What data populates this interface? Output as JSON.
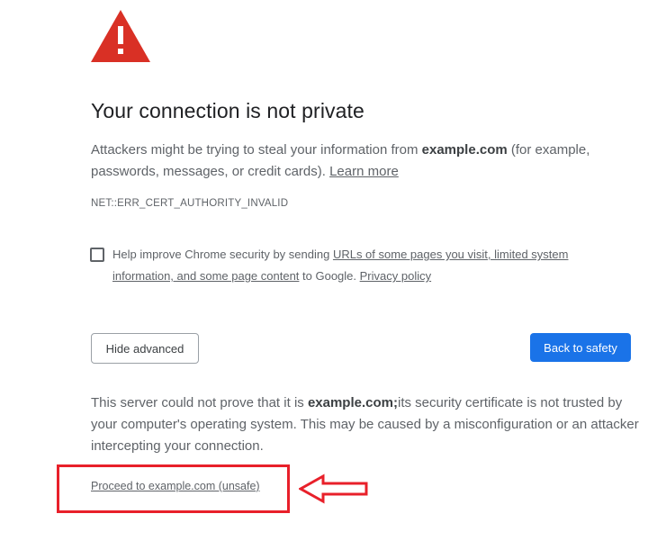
{
  "page": {
    "title": "Your connection is not private",
    "intro": {
      "text1": "Attackers might be trying to steal your information from ",
      "domain": "example.com",
      "text2": " (for example, passwords, messages, or credit cards). ",
      "learn_more": "Learn more"
    },
    "error_code": "NET::ERR_CERT_AUTHORITY_INVALID",
    "optin": {
      "text1": "Help improve Chrome security by sending ",
      "link1": "URLs of some pages you visit, limited system information, and some page content",
      "text2": " to Google. ",
      "privacy_policy": "Privacy policy",
      "checked": false
    },
    "buttons": {
      "hide_advanced": "Hide advanced",
      "back_to_safety": "Back to safety"
    },
    "details": {
      "text1": "This server could not prove that it is ",
      "domain": "example.com;",
      "text2": "its security certificate is not trusted by your computer's operating system. This may be caused by a misconfiguration or an attacker intercepting your connection."
    },
    "proceed_link": "Proceed to example.com (unsafe)"
  },
  "icons": {
    "warning": "warning-triangle-icon",
    "annotation_arrow": "left-arrow-icon"
  },
  "colors": {
    "primary": "#1a73e8",
    "warning": "#d93025",
    "annotation": "#e8202a",
    "text": "#202124",
    "secondary_text": "#5f6368"
  }
}
